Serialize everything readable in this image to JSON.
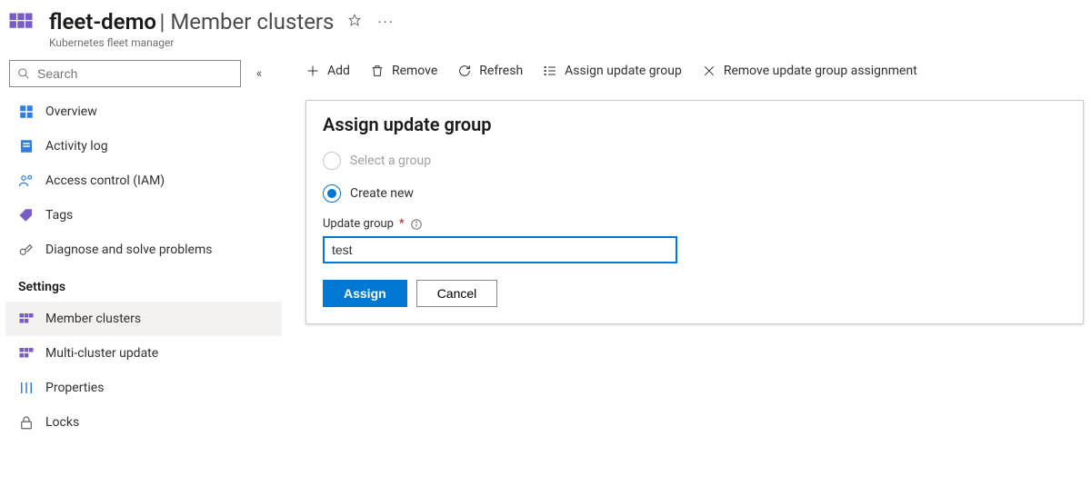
{
  "header": {
    "resource_name": "fleet-demo",
    "page_name": "Member clusters",
    "service_type": "Kubernetes fleet manager"
  },
  "sidebar": {
    "search_placeholder": "Search",
    "items_top": [
      {
        "icon": "overview",
        "label": "Overview"
      },
      {
        "icon": "log",
        "label": "Activity log"
      },
      {
        "icon": "iam",
        "label": "Access control (IAM)"
      },
      {
        "icon": "tags",
        "label": "Tags"
      },
      {
        "icon": "diagnose",
        "label": "Diagnose and solve problems"
      }
    ],
    "section_label": "Settings",
    "items_settings": [
      {
        "icon": "clusters",
        "label": "Member clusters",
        "selected": true
      },
      {
        "icon": "clusters",
        "label": "Multi-cluster update"
      },
      {
        "icon": "props",
        "label": "Properties"
      },
      {
        "icon": "lock",
        "label": "Locks"
      }
    ]
  },
  "toolbar": {
    "add": "Add",
    "remove": "Remove",
    "refresh": "Refresh",
    "assign": "Assign update group",
    "remove_assign": "Remove update group assignment"
  },
  "panel": {
    "title": "Assign update group",
    "option_select": "Select a group",
    "option_create": "Create new",
    "field_label": "Update group",
    "input_value": "test",
    "btn_primary": "Assign",
    "btn_secondary": "Cancel"
  }
}
